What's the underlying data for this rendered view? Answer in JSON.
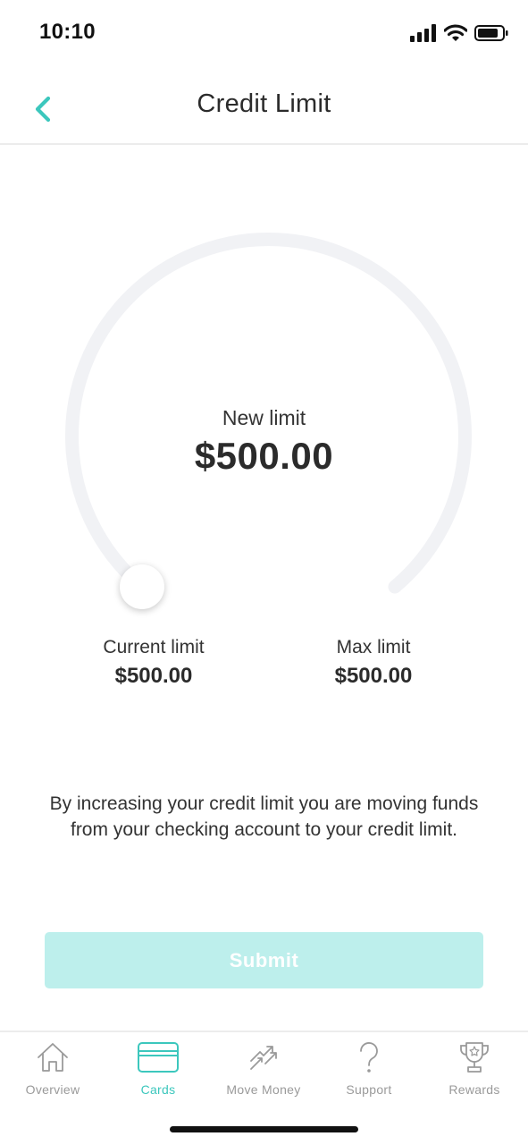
{
  "status_bar": {
    "time": "10:10"
  },
  "header": {
    "title": "Credit Limit"
  },
  "gauge": {
    "label": "New limit",
    "value": "$500.00",
    "slider_position": 0
  },
  "limits": {
    "current_label": "Current limit",
    "current_value": "$500.00",
    "max_label": "Max limit",
    "max_value": "$500.00"
  },
  "info_text": "By increasing your credit limit you are moving funds from your checking account to your credit limit.",
  "submit_label": "Submit",
  "tabs": [
    {
      "label": "Overview",
      "icon": "home-icon",
      "active": false
    },
    {
      "label": "Cards",
      "icon": "card-icon",
      "active": true
    },
    {
      "label": "Move Money",
      "icon": "transfer-icon",
      "active": false
    },
    {
      "label": "Support",
      "icon": "question-icon",
      "active": false
    },
    {
      "label": "Rewards",
      "icon": "trophy-icon",
      "active": false
    }
  ],
  "colors": {
    "accent": "#3cc7bd",
    "submit_disabled": "#bdefec",
    "gauge_track": "#f1f2f5",
    "tab_inactive": "#9a9a9a"
  }
}
